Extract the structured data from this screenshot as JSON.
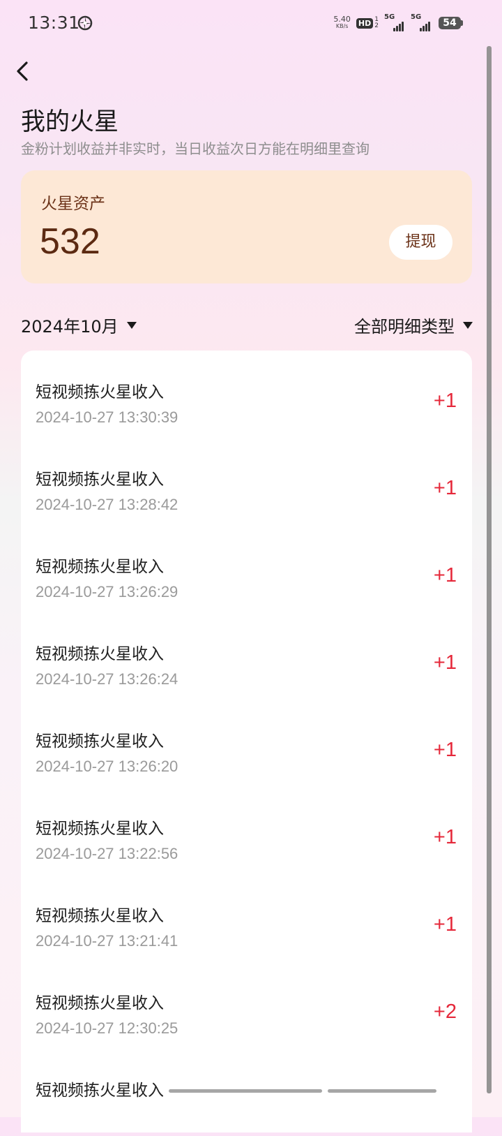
{
  "status_bar": {
    "time": "13:31",
    "net_speed_value": "5.40",
    "net_speed_unit": "KB/s",
    "hd_label": "HD",
    "hd_sub_top": "1",
    "hd_sub_bottom": "2",
    "signal1_label": "5G",
    "signal2_label": "5G",
    "battery": "54",
    "icons": {
      "app": "pinwheel-icon",
      "signal": "signal-bars-icon",
      "battery": "battery-icon"
    }
  },
  "header": {
    "back_icon": "chevron-left-icon",
    "title": "我的火星",
    "subtitle": "金粉计划收益并非实时，当日收益次日方能在明细里查询"
  },
  "asset_card": {
    "label": "火星资产",
    "value": "532",
    "withdraw_label": "提现",
    "background": "#fde8d6"
  },
  "filters": {
    "month": "2024年10月",
    "type": "全部明细类型",
    "dropdown_icon": "triangle-down-icon"
  },
  "records": [
    {
      "title": "短视频拣火星收入",
      "time": "2024-10-27 13:30:39",
      "amount": "+1"
    },
    {
      "title": "短视频拣火星收入",
      "time": "2024-10-27 13:28:42",
      "amount": "+1"
    },
    {
      "title": "短视频拣火星收入",
      "time": "2024-10-27 13:26:29",
      "amount": "+1"
    },
    {
      "title": "短视频拣火星收入",
      "time": "2024-10-27 13:26:24",
      "amount": "+1"
    },
    {
      "title": "短视频拣火星收入",
      "time": "2024-10-27 13:26:20",
      "amount": "+1"
    },
    {
      "title": "短视频拣火星收入",
      "time": "2024-10-27 13:22:56",
      "amount": "+1"
    },
    {
      "title": "短视频拣火星收入",
      "time": "2024-10-27 13:21:41",
      "amount": "+1"
    },
    {
      "title": "短视频拣火星收入",
      "time": "2024-10-27 12:30:25",
      "amount": "+2"
    },
    {
      "title": "短视频拣火星收入",
      "time": "",
      "amount": ""
    }
  ],
  "colors": {
    "amount": "#e5283a",
    "asset_text": "#5c2a12"
  }
}
